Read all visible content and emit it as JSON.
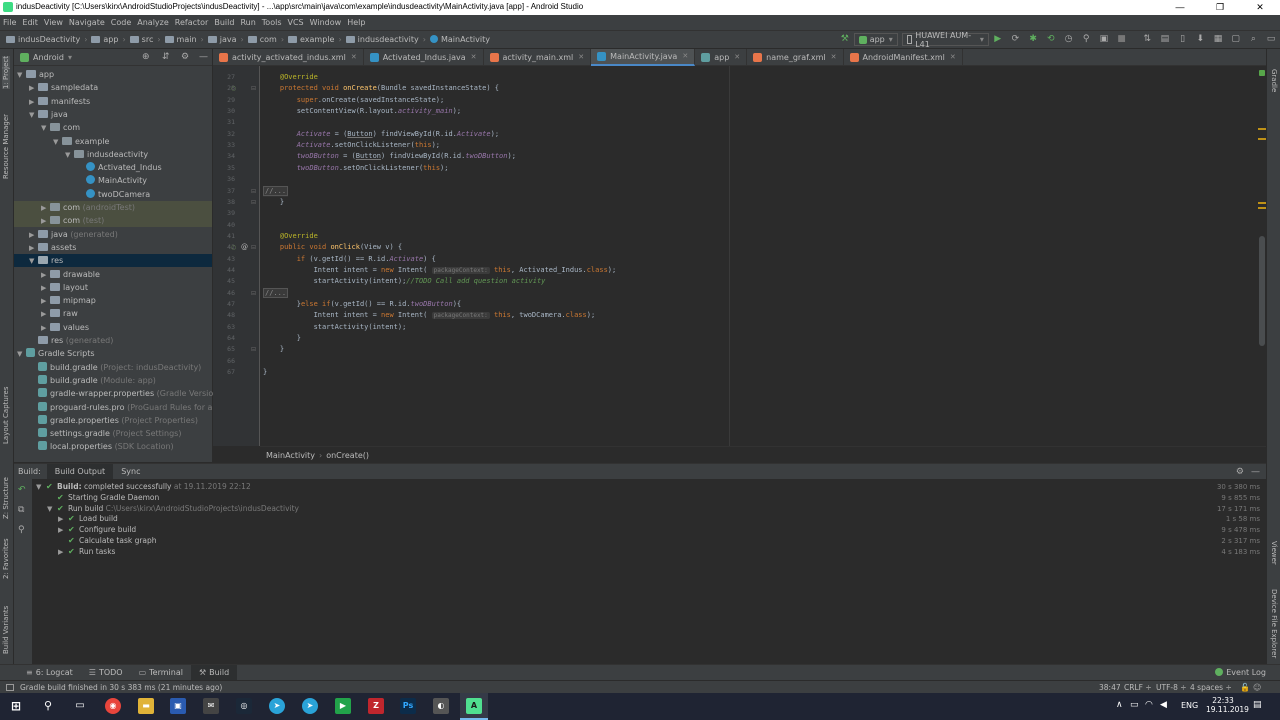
{
  "window": {
    "title": "indusDeactivity [C:\\Users\\kirx\\AndroidStudioProjects\\indusDeactivity] - ...\\app\\src\\main\\java\\com\\example\\indusdeactivity\\MainActivity.java [app] - Android Studio",
    "minimize": "—",
    "maximize": "❐",
    "close": "✕"
  },
  "menu": [
    "File",
    "Edit",
    "View",
    "Navigate",
    "Code",
    "Analyze",
    "Refactor",
    "Build",
    "Run",
    "Tools",
    "VCS",
    "Window",
    "Help"
  ],
  "breadcrumbs": [
    "indusDeactivity",
    "app",
    "src",
    "main",
    "java",
    "com",
    "example",
    "indusdeactivity",
    "MainActivity"
  ],
  "toolbar": {
    "run_config": "app",
    "device": "HUAWEI AUM-L41"
  },
  "project_panel": {
    "view_mode": "Android",
    "tree": [
      {
        "label": "app",
        "hint": "",
        "kind": "folder",
        "depth": 0,
        "arrow": "▼"
      },
      {
        "label": "sampledata",
        "hint": "",
        "kind": "folder",
        "depth": 1,
        "arrow": "▶"
      },
      {
        "label": "manifests",
        "hint": "",
        "kind": "folder",
        "depth": 1,
        "arrow": "▶"
      },
      {
        "label": "java",
        "hint": "",
        "kind": "folder",
        "depth": 1,
        "arrow": "▼"
      },
      {
        "label": "com",
        "hint": "",
        "kind": "pkg",
        "depth": 2,
        "arrow": "▼"
      },
      {
        "label": "example",
        "hint": "",
        "kind": "pkg",
        "depth": 3,
        "arrow": "▼"
      },
      {
        "label": "indusdeactivity",
        "hint": "",
        "kind": "pkg",
        "depth": 4,
        "arrow": "▼"
      },
      {
        "label": "Activated_Indus",
        "hint": "",
        "kind": "class",
        "depth": 5,
        "arrow": ""
      },
      {
        "label": "MainActivity",
        "hint": "",
        "kind": "class",
        "depth": 5,
        "arrow": ""
      },
      {
        "label": "twoDCamera",
        "hint": "",
        "kind": "class",
        "depth": 5,
        "arrow": ""
      },
      {
        "label": "com",
        "hint": "(androidTest)",
        "kind": "pkg",
        "depth": 2,
        "arrow": "▶",
        "hl": true
      },
      {
        "label": "com",
        "hint": "(test)",
        "kind": "pkg",
        "depth": 2,
        "arrow": "▶",
        "hl": true
      },
      {
        "label": "java",
        "hint": "(generated)",
        "kind": "folder",
        "depth": 1,
        "arrow": "▶"
      },
      {
        "label": "assets",
        "hint": "",
        "kind": "folder",
        "depth": 1,
        "arrow": "▶"
      },
      {
        "label": "res",
        "hint": "",
        "kind": "res",
        "depth": 1,
        "arrow": "▼",
        "sel": true
      },
      {
        "label": "drawable",
        "hint": "",
        "kind": "folder",
        "depth": 2,
        "arrow": "▶"
      },
      {
        "label": "layout",
        "hint": "",
        "kind": "folder",
        "depth": 2,
        "arrow": "▶"
      },
      {
        "label": "mipmap",
        "hint": "",
        "kind": "folder",
        "depth": 2,
        "arrow": "▶"
      },
      {
        "label": "raw",
        "hint": "",
        "kind": "folder",
        "depth": 2,
        "arrow": "▶"
      },
      {
        "label": "values",
        "hint": "",
        "kind": "folder",
        "depth": 2,
        "arrow": "▶"
      },
      {
        "label": "res",
        "hint": "(generated)",
        "kind": "folder",
        "depth": 1,
        "arrow": ""
      },
      {
        "label": "Gradle Scripts",
        "hint": "",
        "kind": "gradle",
        "depth": 0,
        "arrow": "▼"
      },
      {
        "label": "build.gradle",
        "hint": "(Project: indusDeactivity)",
        "kind": "gradle",
        "depth": 1,
        "arrow": ""
      },
      {
        "label": "build.gradle",
        "hint": "(Module: app)",
        "kind": "gradle",
        "depth": 1,
        "arrow": ""
      },
      {
        "label": "gradle-wrapper.properties",
        "hint": "(Gradle Version)",
        "kind": "gradle",
        "depth": 1,
        "arrow": ""
      },
      {
        "label": "proguard-rules.pro",
        "hint": "(ProGuard Rules for app)",
        "kind": "gradle",
        "depth": 1,
        "arrow": ""
      },
      {
        "label": "gradle.properties",
        "hint": "(Project Properties)",
        "kind": "gradle",
        "depth": 1,
        "arrow": ""
      },
      {
        "label": "settings.gradle",
        "hint": "(Project Settings)",
        "kind": "gradle",
        "depth": 1,
        "arrow": ""
      },
      {
        "label": "local.properties",
        "hint": "(SDK Location)",
        "kind": "gradle",
        "depth": 1,
        "arrow": ""
      }
    ]
  },
  "editor_tabs": [
    {
      "label": "activity_activated_indus.xml",
      "active": false,
      "color": "#e8754a"
    },
    {
      "label": "Activated_Indus.java",
      "active": false,
      "color": "#3592c4"
    },
    {
      "label": "activity_main.xml",
      "active": false,
      "color": "#e8754a"
    },
    {
      "label": "MainActivity.java",
      "active": true,
      "color": "#3592c4"
    },
    {
      "label": "app",
      "active": false,
      "color": "#5f9ea0"
    },
    {
      "label": "name_graf.xml",
      "active": false,
      "color": "#e8754a"
    },
    {
      "label": "AndroidManifest.xml",
      "active": false,
      "color": "#e8754a"
    }
  ],
  "line_numbers": [
    "27",
    "28",
    "29",
    "30",
    "31",
    "32",
    "33",
    "34",
    "35",
    "36",
    "37",
    "38",
    "39",
    "40",
    "41",
    "42",
    "43",
    "44",
    "45",
    "46",
    "47",
    "48",
    "63",
    "64",
    "65",
    "66",
    "67",
    "68",
    "69",
    "70",
    "71"
  ],
  "code_lines": [
    [
      {
        "t": "    "
      },
      {
        "t": "@Override",
        "c": "an"
      }
    ],
    [
      {
        "t": "    "
      },
      {
        "t": "protected void ",
        "c": "kw"
      },
      {
        "t": "onCreate",
        "c": "fn"
      },
      {
        "t": "(Bundle savedInstanceState) {"
      }
    ],
    [
      {
        "t": "        "
      },
      {
        "t": "super",
        "c": "kw"
      },
      {
        "t": ".onCreate(savedInstanceState);"
      }
    ],
    [
      {
        "t": "        setContentView(R.layout."
      },
      {
        "t": "activity_main",
        "c": "fld"
      },
      {
        "t": ");"
      }
    ],
    [
      {
        "t": ""
      }
    ],
    [
      {
        "t": "        "
      },
      {
        "t": "Activate",
        "c": "fld"
      },
      {
        "t": " = ("
      },
      {
        "t": "Button",
        "c": "ul"
      },
      {
        "t": ") findViewById(R.id."
      },
      {
        "t": "Activate",
        "c": "fld"
      },
      {
        "t": ");"
      }
    ],
    [
      {
        "t": "        "
      },
      {
        "t": "Activate",
        "c": "fld"
      },
      {
        "t": ".setOnClickListener("
      },
      {
        "t": "this",
        "c": "kw"
      },
      {
        "t": ");"
      }
    ],
    [
      {
        "t": "        "
      },
      {
        "t": "twoDButton",
        "c": "fld"
      },
      {
        "t": " = ("
      },
      {
        "t": "Button",
        "c": "ul"
      },
      {
        "t": ") findViewById(R.id."
      },
      {
        "t": "twoDButton",
        "c": "fld"
      },
      {
        "t": ");"
      }
    ],
    [
      {
        "t": "        "
      },
      {
        "t": "twoDButton",
        "c": "fld"
      },
      {
        "t": ".setOnClickListener("
      },
      {
        "t": "this",
        "c": "kw"
      },
      {
        "t": ");"
      }
    ],
    [
      {
        "t": ""
      }
    ],
    [
      {
        "t": "//...",
        "c": "fold-mark"
      }
    ],
    [
      {
        "t": "    }"
      }
    ],
    [
      {
        "t": ""
      }
    ],
    [
      {
        "t": ""
      }
    ],
    [
      {
        "t": "    "
      },
      {
        "t": "@Override",
        "c": "an"
      }
    ],
    [
      {
        "t": "    "
      },
      {
        "t": "public void ",
        "c": "kw"
      },
      {
        "t": "onClick",
        "c": "fn"
      },
      {
        "t": "(View v) {"
      }
    ],
    [
      {
        "t": "        "
      },
      {
        "t": "if ",
        "c": "kw"
      },
      {
        "t": "(v.getId() == R.id."
      },
      {
        "t": "Activate",
        "c": "fld"
      },
      {
        "t": ") {"
      }
    ],
    [
      {
        "t": "            Intent intent = "
      },
      {
        "t": "new ",
        "c": "kw"
      },
      {
        "t": "Intent( "
      },
      {
        "t": "packageContext:",
        "c": "hint"
      },
      {
        "t": " "
      },
      {
        "t": "this",
        "c": "kw"
      },
      {
        "t": ", Activated_Indus."
      },
      {
        "t": "class",
        "c": "kw"
      },
      {
        "t": ");"
      }
    ],
    [
      {
        "t": "            startActivity(intent);"
      },
      {
        "t": "//TODO Call add question activity",
        "c": "cmt"
      }
    ],
    [
      {
        "t": "//...",
        "c": "fold-mark"
      }
    ],
    [
      {
        "t": "        }"
      },
      {
        "t": "else if",
        "c": "kw"
      },
      {
        "t": "(v.getId() == R.id."
      },
      {
        "t": "twoDButton",
        "c": "fld"
      },
      {
        "t": "){"
      }
    ],
    [
      {
        "t": "            Intent intent = "
      },
      {
        "t": "new ",
        "c": "kw"
      },
      {
        "t": "Intent( "
      },
      {
        "t": "packageContext:",
        "c": "hint"
      },
      {
        "t": " "
      },
      {
        "t": "this",
        "c": "kw"
      },
      {
        "t": ", twoDCamera."
      },
      {
        "t": "class",
        "c": "kw"
      },
      {
        "t": ");"
      }
    ],
    [
      {
        "t": "            startActivity(intent);"
      }
    ],
    [
      {
        "t": "        }"
      }
    ],
    [
      {
        "t": "    }"
      }
    ],
    [
      {
        "t": ""
      }
    ],
    [
      {
        "t": "}"
      }
    ]
  ],
  "editor_breadcrumb": [
    "MainActivity",
    "onCreate()"
  ],
  "build_panel": {
    "label": "Build:",
    "tabs": [
      "Build Output",
      "Sync"
    ],
    "tree": [
      {
        "text": "Build:",
        "rest": " completed successfully",
        "meta": " at 19.11.2019 22:12",
        "time": "30 s 380 ms",
        "depth": 0,
        "arrow": "▼"
      },
      {
        "text": "Starting Gradle Daemon",
        "rest": "",
        "meta": "",
        "time": "9 s 855 ms",
        "depth": 1,
        "arrow": ""
      },
      {
        "text": "Run build",
        "rest": "",
        "meta": " C:\\Users\\kirx\\AndroidStudioProjects\\indusDeactivity",
        "time": "17 s 171 ms",
        "depth": 1,
        "arrow": "▼"
      },
      {
        "text": "Load build",
        "rest": "",
        "meta": "",
        "time": "1 s 58 ms",
        "depth": 2,
        "arrow": "▶"
      },
      {
        "text": "Configure build",
        "rest": "",
        "meta": "",
        "time": "9 s 478 ms",
        "depth": 2,
        "arrow": "▶"
      },
      {
        "text": "Calculate task graph",
        "rest": "",
        "meta": "",
        "time": "2 s 317 ms",
        "depth": 2,
        "arrow": ""
      },
      {
        "text": "Run tasks",
        "rest": "",
        "meta": "",
        "time": "4 s 183 ms",
        "depth": 2,
        "arrow": "▶"
      }
    ]
  },
  "side_tabs_left": [
    "1: Project",
    "Resource Manager",
    "Layout Captures",
    "Z: Structure",
    "2: Favorites",
    "Build Variants"
  ],
  "side_tabs_right": [
    "Gradle",
    "Viewer",
    "Device File Explorer"
  ],
  "bottom_tabs": [
    {
      "label": "6: Logcat",
      "active": false
    },
    {
      "label": "TODO",
      "active": false
    },
    {
      "label": "Terminal",
      "active": false
    },
    {
      "label": "Build",
      "active": true
    }
  ],
  "event_log": "Event Log",
  "status": {
    "message": "Gradle build finished in 30 s 383 ms (21 minutes ago)",
    "position": "38:47",
    "line_sep": "CRLF ÷",
    "encoding": "UTF-8 ÷",
    "indent": "4 spaces ÷"
  },
  "taskbar": {
    "lang": "ENG",
    "time": "22:33",
    "date": "19.11.2019"
  }
}
